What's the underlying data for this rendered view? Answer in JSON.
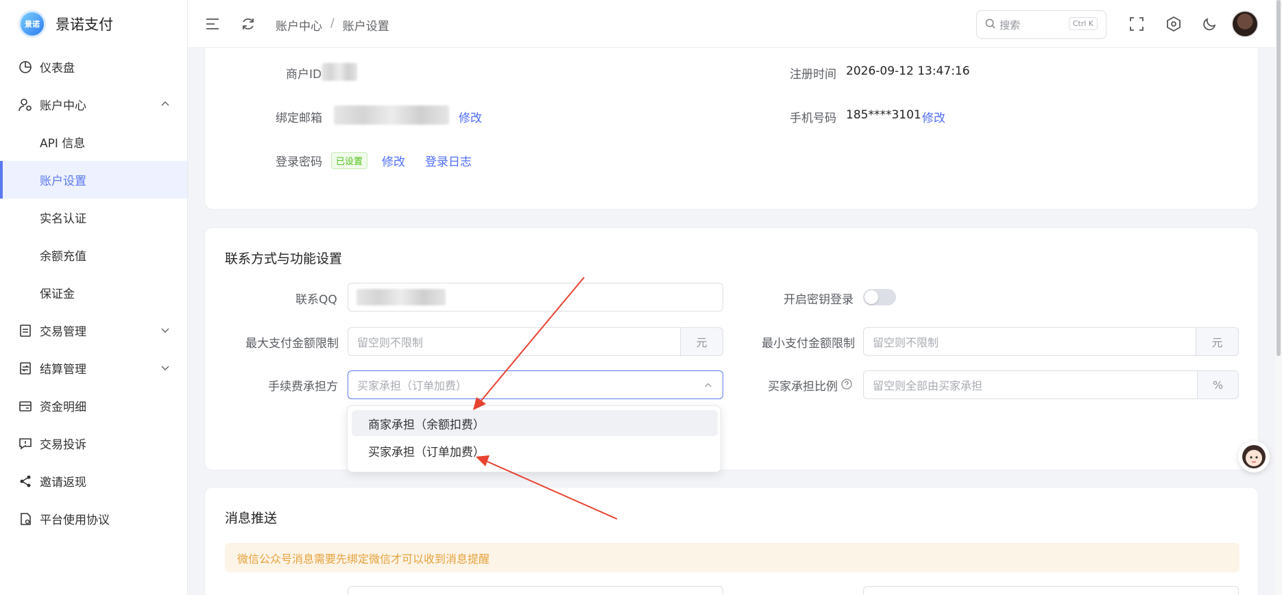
{
  "brand": {
    "name": "景诺支付",
    "logo_text": "景诺"
  },
  "sidebar": {
    "items": [
      {
        "label": "仪表盘",
        "icon": "pie-chart-icon"
      },
      {
        "label": "账户中心",
        "icon": "user-settings-icon"
      },
      {
        "label": "API 信息"
      },
      {
        "label": "账户设置"
      },
      {
        "label": "实名认证"
      },
      {
        "label": "余额充值"
      },
      {
        "label": "保证金"
      },
      {
        "label": "交易管理",
        "icon": "document-icon"
      },
      {
        "label": "结算管理",
        "icon": "settlement-icon"
      },
      {
        "label": "资金明细",
        "icon": "wallet-icon"
      },
      {
        "label": "交易投诉",
        "icon": "alert-icon"
      },
      {
        "label": "邀请返现",
        "icon": "share-icon"
      },
      {
        "label": "平台使用协议",
        "icon": "file-icon"
      }
    ]
  },
  "header": {
    "breadcrumb": [
      "账户中心",
      "/",
      "账户设置"
    ],
    "search_placeholder": "搜索",
    "search_shortcut": "Ctrl K"
  },
  "account": {
    "merchant_id_label": "商户ID",
    "register_time_label": "注册时间",
    "register_time": "2026-09-12 13:47:16",
    "email_label": "绑定邮箱",
    "email_edit": "修改",
    "phone_label": "手机号码",
    "phone": "185****3101",
    "phone_edit": "修改",
    "password_label": "登录密码",
    "password_status": "已设置",
    "password_edit": "修改",
    "login_log": "登录日志"
  },
  "contact": {
    "title": "联系方式与功能设置",
    "qq_label": "联系QQ",
    "secret_login_label": "开启密钥登录",
    "max_pay_label": "最大支付金额限制",
    "max_pay_placeholder": "留空则不限制",
    "max_pay_unit": "元",
    "min_pay_label": "最小支付金额限制",
    "min_pay_placeholder": "留空则不限制",
    "min_pay_unit": "元",
    "fee_payer_label": "手续费承担方",
    "fee_payer_value": "买家承担（订单加费）",
    "buyer_ratio_label": "买家承担比例",
    "buyer_ratio_placeholder": "留空则全部由买家承担",
    "buyer_ratio_unit": "%",
    "fee_options": [
      "商家承担（余额扣费）",
      "买家承担（订单加费）"
    ]
  },
  "push": {
    "title": "消息推送",
    "notice": "微信公众号消息需要先绑定微信才可以收到消息提醒"
  },
  "colors": {
    "accent": "#5a78f0",
    "link": "#4f6ef7",
    "annotation": "#e8412f"
  }
}
